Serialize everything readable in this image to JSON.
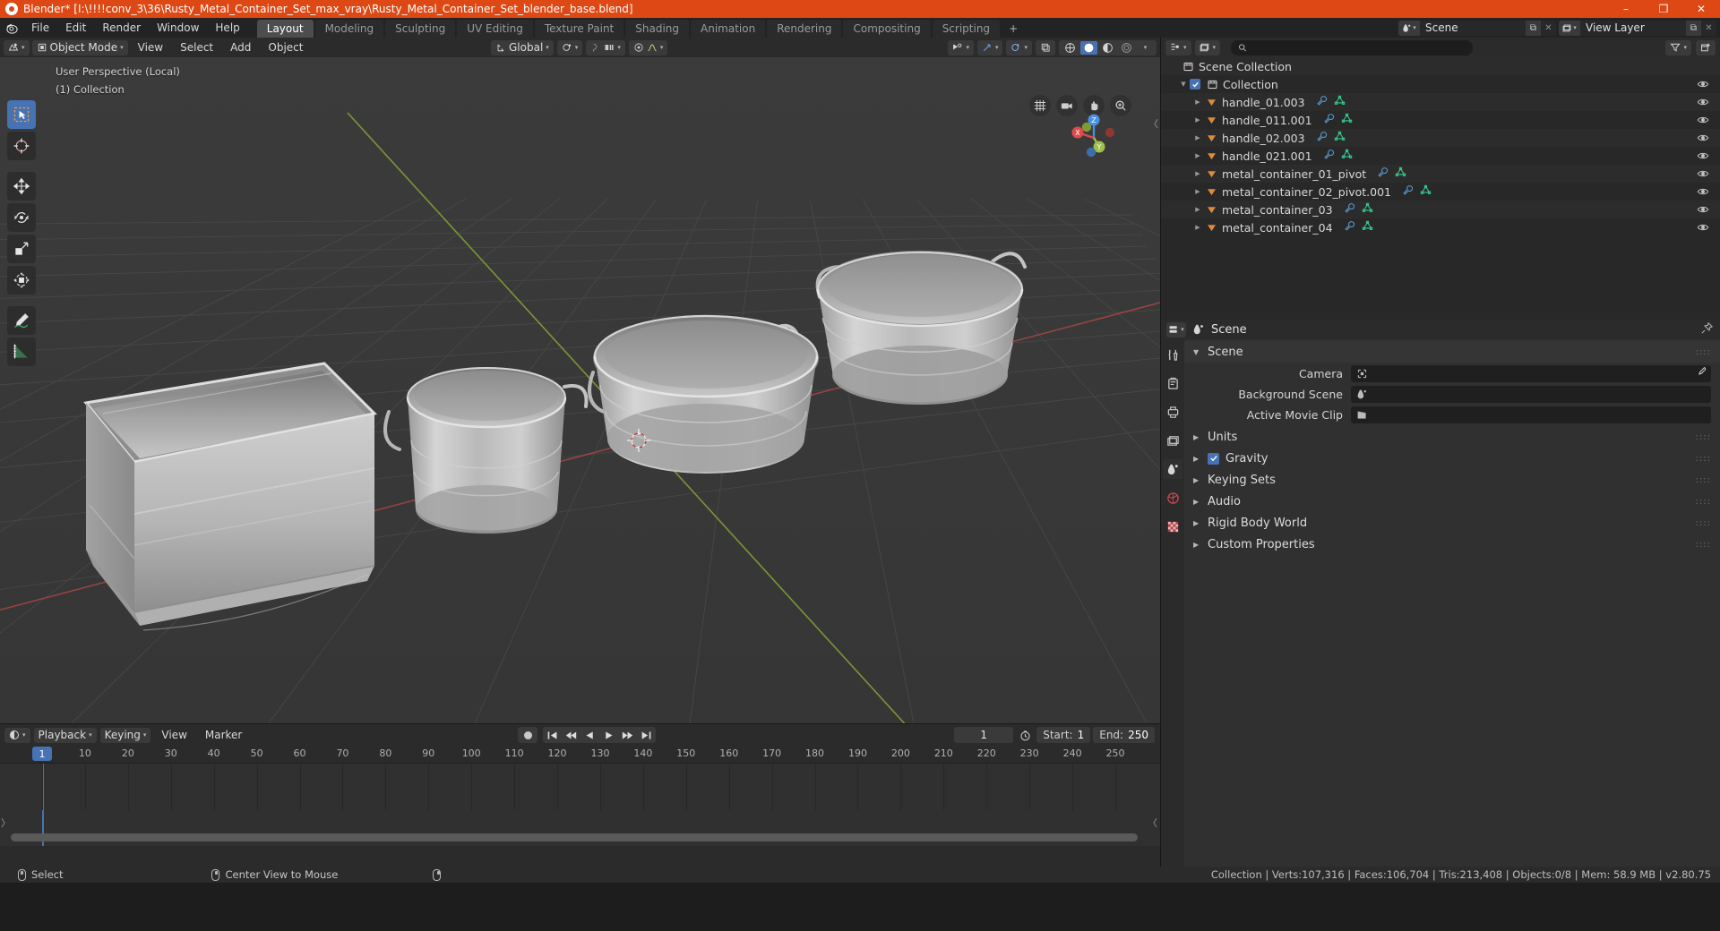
{
  "titlebar": {
    "app_title": "Blender* [I:\\!!!!conv_3\\36\\Rusty_Metal_Container_Set_max_vray\\Rusty_Metal_Container_Set_blender_base.blend]",
    "minimize": "–",
    "maximize": "❐",
    "close": "✕"
  },
  "topbar": {
    "menus": [
      "File",
      "Edit",
      "Render",
      "Window",
      "Help"
    ],
    "workspaces": [
      {
        "label": "Layout",
        "active": true
      },
      {
        "label": "Modeling",
        "active": false
      },
      {
        "label": "Sculpting",
        "active": false
      },
      {
        "label": "UV Editing",
        "active": false
      },
      {
        "label": "Texture Paint",
        "active": false
      },
      {
        "label": "Shading",
        "active": false
      },
      {
        "label": "Animation",
        "active": false
      },
      {
        "label": "Rendering",
        "active": false
      },
      {
        "label": "Compositing",
        "active": false
      },
      {
        "label": "Scripting",
        "active": false
      }
    ],
    "add_workspace": "+",
    "scene_name": "Scene",
    "view_layer_name": "View Layer",
    "copy_glyph": "⧉",
    "close_glyph": "✕"
  },
  "viewport": {
    "mode": "Object Mode",
    "menus": [
      "View",
      "Select",
      "Add",
      "Object"
    ],
    "transform_orientation": "Global",
    "overlay_line1": "User Perspective (Local)",
    "overlay_line2": "(1) Collection",
    "tools": [
      {
        "name": "tweak-select-box",
        "active": true
      },
      {
        "name": "cursor",
        "active": false
      },
      {
        "name": "move",
        "active": false
      },
      {
        "name": "rotate",
        "active": false
      },
      {
        "name": "scale",
        "active": false
      },
      {
        "name": "transform",
        "active": false
      },
      {
        "name": "annotate",
        "active": false
      },
      {
        "name": "measure",
        "active": false
      }
    ],
    "nav_buttons": [
      "grid-toggle-icon",
      "camera-view-icon",
      "hand-pan-icon",
      "zoom-icon"
    ],
    "gizmo_axes": [
      "X",
      "Y",
      "Z"
    ]
  },
  "outliner": {
    "search_placeholder": "",
    "rows": [
      {
        "label": "Scene Collection",
        "indent": 0,
        "icon": "scene-collection-icon",
        "disclosure": "",
        "checkbox": false,
        "mods": [],
        "eye": false
      },
      {
        "label": "Collection",
        "indent": 1,
        "icon": "collection-icon",
        "disclosure": "▼",
        "checkbox": true,
        "mods": [],
        "eye": true
      },
      {
        "label": "handle_01.003",
        "indent": 2,
        "icon": "mesh-object-icon",
        "disclosure": "▶",
        "checkbox": false,
        "mods": [
          "modifier-icon",
          "mesh-data-icon"
        ],
        "eye": true
      },
      {
        "label": "handle_011.001",
        "indent": 2,
        "icon": "mesh-object-icon",
        "disclosure": "▶",
        "checkbox": false,
        "mods": [
          "modifier-icon",
          "mesh-data-icon"
        ],
        "eye": true
      },
      {
        "label": "handle_02.003",
        "indent": 2,
        "icon": "mesh-object-icon",
        "disclosure": "▶",
        "checkbox": false,
        "mods": [
          "modifier-icon",
          "mesh-data-icon"
        ],
        "eye": true
      },
      {
        "label": "handle_021.001",
        "indent": 2,
        "icon": "mesh-object-icon",
        "disclosure": "▶",
        "checkbox": false,
        "mods": [
          "modifier-icon",
          "mesh-data-icon"
        ],
        "eye": true
      },
      {
        "label": "metal_container_01_pivot",
        "indent": 2,
        "icon": "mesh-object-icon",
        "disclosure": "▶",
        "checkbox": false,
        "mods": [
          "modifier-icon",
          "mesh-data-icon"
        ],
        "eye": true
      },
      {
        "label": "metal_container_02_pivot.001",
        "indent": 2,
        "icon": "mesh-object-icon",
        "disclosure": "▶",
        "checkbox": false,
        "mods": [
          "modifier-icon",
          "mesh-data-icon"
        ],
        "eye": true
      },
      {
        "label": "metal_container_03",
        "indent": 2,
        "icon": "mesh-object-icon",
        "disclosure": "▶",
        "checkbox": false,
        "mods": [
          "modifier-icon",
          "mesh-data-icon"
        ],
        "eye": true
      },
      {
        "label": "metal_container_04",
        "indent": 2,
        "icon": "mesh-object-icon",
        "disclosure": "▶",
        "checkbox": false,
        "mods": [
          "modifier-icon",
          "mesh-data-icon"
        ],
        "eye": true
      }
    ]
  },
  "properties": {
    "breadcrumb": "Scene",
    "sections": [
      {
        "label": "Scene",
        "open": true,
        "checkbox": false
      },
      {
        "label": "Units",
        "open": false,
        "checkbox": false
      },
      {
        "label": "Gravity",
        "open": false,
        "checkbox": true
      },
      {
        "label": "Keying Sets",
        "open": false,
        "checkbox": false
      },
      {
        "label": "Audio",
        "open": false,
        "checkbox": false
      },
      {
        "label": "Rigid Body World",
        "open": false,
        "checkbox": false
      },
      {
        "label": "Custom Properties",
        "open": false,
        "checkbox": false
      }
    ],
    "fields": [
      {
        "label": "Camera",
        "value": "",
        "icon": "camera-icon",
        "eyedropper": true
      },
      {
        "label": "Background Scene",
        "value": "",
        "icon": "scene-icon",
        "eyedropper": false
      },
      {
        "label": "Active Movie Clip",
        "value": "",
        "icon": "movie-clip-icon",
        "eyedropper": false
      }
    ],
    "tabs": [
      {
        "name": "tool-tab",
        "active": false
      },
      {
        "name": "render-tab",
        "active": false
      },
      {
        "name": "output-tab",
        "active": false
      },
      {
        "name": "view-layer-tab",
        "active": false
      },
      {
        "name": "scene-tab",
        "active": true
      },
      {
        "name": "world-tab",
        "active": false
      },
      {
        "name": "texture-tab",
        "active": false
      }
    ]
  },
  "timeline": {
    "menus": [
      "Playback",
      "Keying",
      "View",
      "Marker"
    ],
    "current_frame": "1",
    "start_label": "Start:",
    "start_value": "1",
    "end_label": "End:",
    "end_value": "250",
    "ticks": [
      "1",
      "10",
      "20",
      "30",
      "40",
      "50",
      "60",
      "70",
      "80",
      "90",
      "100",
      "110",
      "120",
      "130",
      "140",
      "150",
      "160",
      "170",
      "180",
      "190",
      "200",
      "210",
      "220",
      "230",
      "240",
      "250"
    ],
    "playhead_frame": "1"
  },
  "statusbar": {
    "items": [
      {
        "icon": "mouse-left-icon",
        "label": "Select"
      },
      {
        "icon": "mouse-middle-icon",
        "label": "Center View to Mouse"
      },
      {
        "icon": "mouse-right-icon",
        "label": ""
      }
    ],
    "stats": "Collection | Verts:107,316 | Faces:106,704 | Tris:213,408 | Objects:0/8 | Mem: 58.9 MB | v2.80.75"
  },
  "colors": {
    "accent_orange": "#dd4814",
    "accent_blue": "#4772b3",
    "axis_x": "#e04a4a",
    "axis_y": "#9ec14a",
    "axis_z": "#4a8fe0"
  }
}
